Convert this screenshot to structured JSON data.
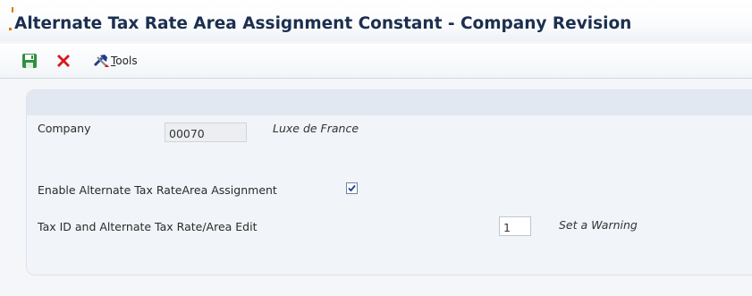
{
  "window": {
    "title": "Alternate Tax Rate Area Assignment Constant - Company Revision"
  },
  "toolbar": {
    "save_icon": "save-icon",
    "cancel_icon": "cancel-icon",
    "tools_icon": "tools-icon",
    "tools_label_first": "T",
    "tools_label_rest": "ools"
  },
  "form": {
    "company_label": "Company",
    "company_value": "00070",
    "company_name": "Luxe de France",
    "enable_label": "Enable Alternate Tax RateArea Assignment",
    "enable_checked": true,
    "taxid_label": "Tax ID and Alternate Tax Rate/Area Edit",
    "taxid_value": "1",
    "taxid_description": "Set a Warning"
  },
  "colors": {
    "title": "#1c2f4f",
    "accent": "#e07800",
    "panel_header": "#e1e8f1"
  }
}
